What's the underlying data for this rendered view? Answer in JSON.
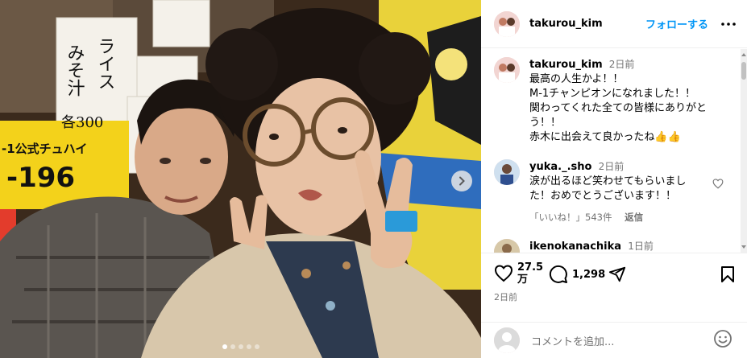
{
  "post": {
    "author": "takurou_kim",
    "follow_label": "フォローする",
    "image_count": 5,
    "active_image_index": 0
  },
  "photo": {
    "signs": [
      {
        "text": "みそ汁"
      },
      {
        "text": "ライス"
      },
      {
        "text": "各300"
      },
      {
        "text": "-1公式チュハイ"
      },
      {
        "text": "-196"
      }
    ]
  },
  "caption": {
    "author": "takurou_kim",
    "time": "2日前",
    "lines": [
      "最高の人生かよ！！",
      "M-1チャンピオンになれました！！",
      "関わってくれた全ての皆様にありがと",
      "う！！",
      "赤木に出会えて良かったね👍👍"
    ]
  },
  "comments": [
    {
      "author": "yuka._.sho",
      "time": "2日前",
      "lines": [
        "涙が出るほど笑わせてもらいまし",
        "た！おめでとうございます！！"
      ],
      "likes_label": "「いいね！」543件",
      "reply_label": "返信"
    },
    {
      "author": "ikenokanachika",
      "time": "1日前"
    }
  ],
  "stats": {
    "likes_line1": "27.5",
    "likes_line2": "万",
    "comments": "1,298",
    "date": "2日前"
  },
  "add_comment": {
    "placeholder": "コメントを追加..."
  },
  "icons": {
    "more": "more-icon",
    "heart": "heart-icon",
    "comment": "comment-icon",
    "share": "share-icon",
    "save": "bookmark-icon",
    "emoji": "emoji-icon",
    "next": "chevron-right-icon"
  },
  "colors": {
    "accent": "#0095f6",
    "muted": "#737373"
  }
}
